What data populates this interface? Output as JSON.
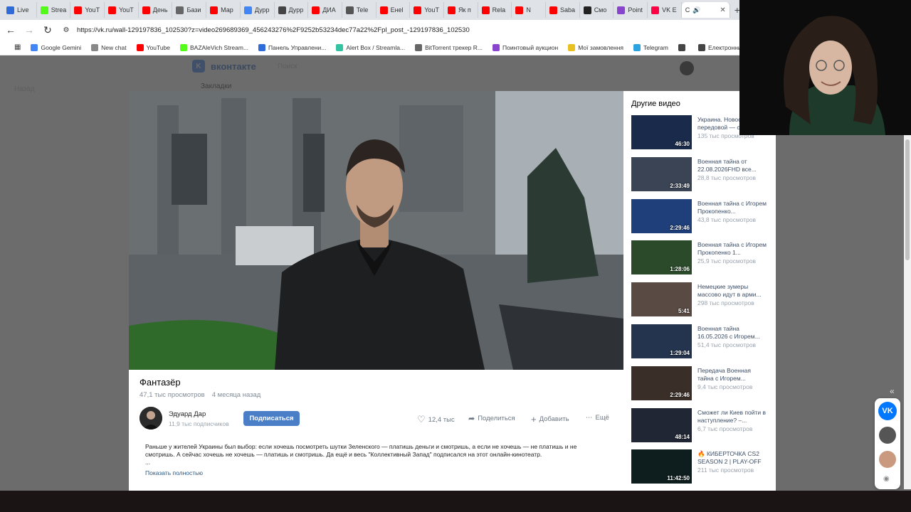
{
  "browser": {
    "tabs": [
      {
        "label": "Live",
        "color": "#2f6bd9"
      },
      {
        "label": "Strea",
        "color": "#53fc18"
      },
      {
        "label": "YouT",
        "color": "#ff0000"
      },
      {
        "label": "YouT",
        "color": "#ff0000"
      },
      {
        "label": "День",
        "color": "#ff0000"
      },
      {
        "label": "Бази",
        "color": "#666666"
      },
      {
        "label": "Мар",
        "color": "#ff0000"
      },
      {
        "label": "Дурр",
        "color": "#4285f4"
      },
      {
        "label": "Дурр",
        "color": "#444444"
      },
      {
        "label": "ДИА",
        "color": "#ff0000"
      },
      {
        "label": "Tele",
        "color": "#555555"
      },
      {
        "label": "Енеl",
        "color": "#ff0000"
      },
      {
        "label": "YouT",
        "color": "#ff0000"
      },
      {
        "label": "Як п",
        "color": "#ff0000"
      },
      {
        "label": "Rela",
        "color": "#ff0000"
      },
      {
        "label": "N",
        "color": "#ff0000"
      },
      {
        "label": "Saba",
        "color": "#ff0000"
      },
      {
        "label": "Смо",
        "color": "#222222"
      },
      {
        "label": "Point",
        "color": "#8844cc"
      },
      {
        "label": "VK E",
        "color": "#ff0044"
      }
    ],
    "active_tab_label": "C",
    "url": "https://vk.ru/wall-129197836_102530?z=video269689369_456243276%2F9252b53234dec77a22%2Fpl_post_-129197836_102530",
    "bookmarks": [
      {
        "label": "Google Gemini",
        "color": "#4285f4"
      },
      {
        "label": "New chat",
        "color": "#888888"
      },
      {
        "label": "YouTube",
        "color": "#ff0000"
      },
      {
        "label": "BAZAleVich Stream...",
        "color": "#53fc18"
      },
      {
        "label": "Панель Управлени...",
        "color": "#2f6bd9"
      },
      {
        "label": "Alert Box / Streamla...",
        "color": "#31c3a2"
      },
      {
        "label": "BitTorrent трекер R...",
        "color": "#666666"
      },
      {
        "label": "Поинтовый аукцион",
        "color": "#8844cc"
      },
      {
        "label": "Мої замовлення",
        "color": "#e8c020"
      },
      {
        "label": "Telegram",
        "color": "#2aa3e0"
      },
      {
        "label": "",
        "color": "#444444"
      },
      {
        "label": "Електронний кабінет",
        "color": "#444444"
      }
    ]
  },
  "vk_page": {
    "logo_text": "вконтакте",
    "search_placeholder": "Поиск",
    "bookmarks_link": "Закладки",
    "back_link": "Назад"
  },
  "video": {
    "title": "Фантазёр",
    "views": "47,1 тыс просмотров",
    "age": "4 месяца назад",
    "author_name": "Эдуард Дар",
    "author_subs": "11,9 тыс подписчиков",
    "subscribe_label": "Подписаться",
    "likes": "12,4 тыс",
    "share_label": "Поделиться",
    "add_label": "Добавить",
    "more_label": "Ещё",
    "description": "Раньше у жителей Украины был выбор: если хочешь посмотреть шутки Зеленского — платишь деньги и смотришь, а если не хочешь — не платишь и не смотришь. А сейчас хочешь не хочешь — платишь и смотришь. Да ещё и весь \"Коллективный Запад\" подписался на этот онлайн-кинотеатр.",
    "description_ellipsis": "...",
    "show_more": "Показать полностью"
  },
  "sidebar": {
    "title": "Другие видео",
    "items": [
      {
        "title": "Украина. Новости с передовой — с...",
        "views": "135 тыс просмотров",
        "duration": "46:30",
        "thumb": "#1a2a4a"
      },
      {
        "title": "Военная тайна от 22.08.2026FHD все...",
        "views": "28,8 тыс просмотров",
        "duration": "2:33:49",
        "thumb": "#3a4454"
      },
      {
        "title": "Военная тайна с Игорем Прокопенко...",
        "views": "43,8 тыс просмотров",
        "duration": "2:29:46",
        "thumb": "#1f3f7a"
      },
      {
        "title": "Военная тайна с Игорем Прокопенко 1...",
        "views": "25,9 тыс просмотров",
        "duration": "1:28:06",
        "thumb": "#2a4a2a"
      },
      {
        "title": "Немецкие зумеры массово идут в арми...",
        "views": "298 тыс просмотров",
        "duration": "5:41",
        "thumb": "#5a4a44"
      },
      {
        "title": "Военная тайна 16.05.2026 с Игорем...",
        "views": "51,4 тыс просмотров",
        "duration": "1:29:04",
        "thumb": "#24344e"
      },
      {
        "title": "Передача Военная тайна с Игорем...",
        "views": "9,4 тыс просмотров",
        "duration": "2:29:46",
        "thumb": "#3a2f28"
      },
      {
        "title": "Сможет ли Киев пойти в наступление? –...",
        "views": "6,7 тыс просмотров",
        "duration": "48:14",
        "thumb": "#202634"
      },
      {
        "title": "🔥 КИБЕРТОЧКА CS2 SEASON 2 | PLAY-OFF |...",
        "views": "211 тыс просмотров",
        "duration": "11:42:50",
        "thumb": "#0e1e1e"
      }
    ]
  },
  "widget": {
    "vk_label": "VK"
  }
}
